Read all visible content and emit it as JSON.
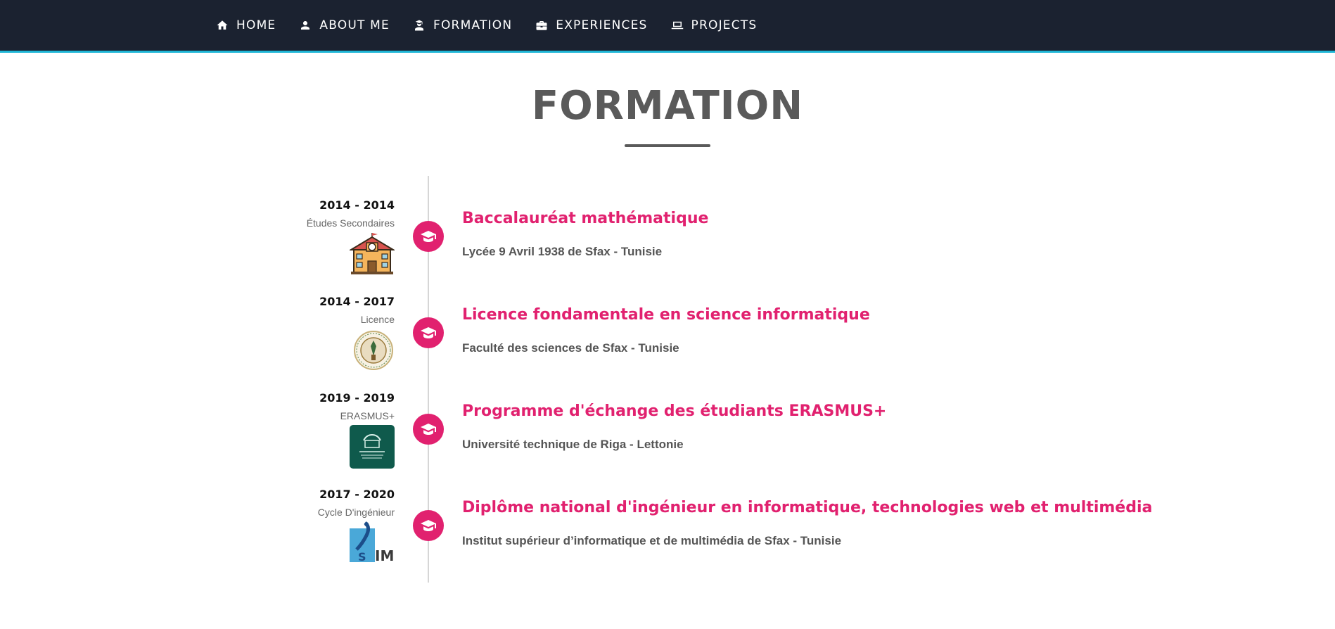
{
  "nav": {
    "items": [
      {
        "label": "HOME",
        "icon": "home-icon"
      },
      {
        "label": "ABOUT ME",
        "icon": "person-icon"
      },
      {
        "label": "FORMATION",
        "icon": "student-icon"
      },
      {
        "label": "EXPERIENCES",
        "icon": "briefcase-icon"
      },
      {
        "label": "PROJECTS",
        "icon": "laptop-icon"
      }
    ],
    "accent": "#1fb6d6",
    "background": "#1b2230"
  },
  "section": {
    "title": "FORMATION"
  },
  "timeline": {
    "accent": "#e1216f",
    "entries": [
      {
        "years": "2014 - 2014",
        "level": "Études Secondaires",
        "logo": "school-building-icon",
        "degree": "Baccalauréat mathématique",
        "school": "Lycée 9 Avril 1938 de Sfax - Tunisie"
      },
      {
        "years": "2014 - 2017",
        "level": "Licence",
        "logo": "faculty-seal-logo",
        "degree": "Licence fondamentale en science informatique",
        "school": "Faculté des sciences de Sfax - Tunisie"
      },
      {
        "years": "2019 - 2019",
        "level": "ERASMUS+",
        "logo": "university-logo",
        "degree": "Programme d'échange des étudiants ERASMUS+",
        "school": "Université technique de Riga - Lettonie"
      },
      {
        "years": "2017 - 2020",
        "level": "Cycle D'ingénieur",
        "logo": "isim-logo",
        "logo_text": "IM",
        "degree": "Diplôme national d'ingénieur en informatique, technologies web et multimédia",
        "school": "Institut supérieur d’informatique et de multimédia de Sfax - Tunisie"
      }
    ]
  }
}
